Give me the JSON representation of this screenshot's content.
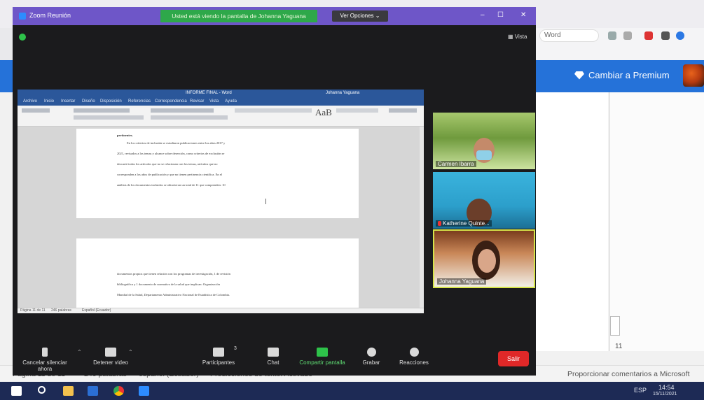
{
  "background_app": {
    "address_partial": "Word",
    "premium_label": "Cambiar a Premium",
    "page_number": "11",
    "status": {
      "page": "Página 11 de 11",
      "words": "246 palabras",
      "language": "español (Ecuador)",
      "accessibility": "Predicciones de texto: Activado",
      "feedback": "Proporcionar comentarios a Microsoft"
    },
    "colors": {
      "accent": "#2572d9",
      "taskbar": "#1d2a55"
    }
  },
  "taskbar": {
    "icons": [
      "windows-icon",
      "search-icon",
      "file-explorer-icon",
      "word-icon",
      "chrome-icon",
      "zoom-icon"
    ],
    "lang": "ESP",
    "time": "14:54",
    "date": "15/11/2021"
  },
  "zoom": {
    "title": "Zoom Reunión",
    "share_banner": "Usted está viendo la pantalla de Johanna Yaguana",
    "view_options": "Ver Opciones",
    "view_label": "Vista",
    "colors": {
      "titlebar": "#6e56c8",
      "share": "#2ea84a",
      "leave": "#e02828"
    },
    "shared_doc": {
      "filename": "INFORME FINAL - Word",
      "user": "Johanna Yaguana",
      "menu": [
        "Archivo",
        "Inicio",
        "Insertar",
        "Diseño",
        "Disposición",
        "Referencias",
        "Correspondencia",
        "Revisar",
        "Vista",
        "Ayuda"
      ],
      "styles_sample": "AaB",
      "page1_heading": "pertinentes.",
      "page1_text": [
        "En los criterios de inclusión se estudiaron publicaciones entre los años 2017 y",
        "2021, revisados a los temas y alcance sobre deserción, como criterios de exclusión se",
        "descartó todos los artículos que no se relacionan con los temas, artículos que no",
        "corresponden a los años de publicación y que no tienen pertinencia científica. En el",
        "análisis de los documentos incluidos se obtuvieron un total de 11 que comprenden: 10"
      ],
      "page2_text": [
        "documentos propios que tienen relación con los programas de investigación, 1 de revisión",
        "bibliográfica y 1 documento de normativa de la salud que implican: Organización",
        "Mundial de la Salud, Departamento Administrativo Nacional de Estadística de Colombia."
      ],
      "status": [
        "Página 11 de 11",
        "246 palabras",
        "Español (Ecuador)"
      ]
    },
    "participants": [
      {
        "name": "Carmen Ibarra",
        "muted": false
      },
      {
        "name": "Katherine Quinte...",
        "muted": true
      },
      {
        "name": "Johanna Yaguana",
        "muted": false,
        "active_speaker": true
      }
    ],
    "toolbar": {
      "mute": "Cancelar silenciar ahora",
      "video": "Detener video",
      "participants": "Participantes",
      "participants_count": "3",
      "chat": "Chat",
      "share": "Compartir pantalla",
      "record": "Grabar",
      "reactions": "Reacciones",
      "leave": "Salir"
    }
  }
}
